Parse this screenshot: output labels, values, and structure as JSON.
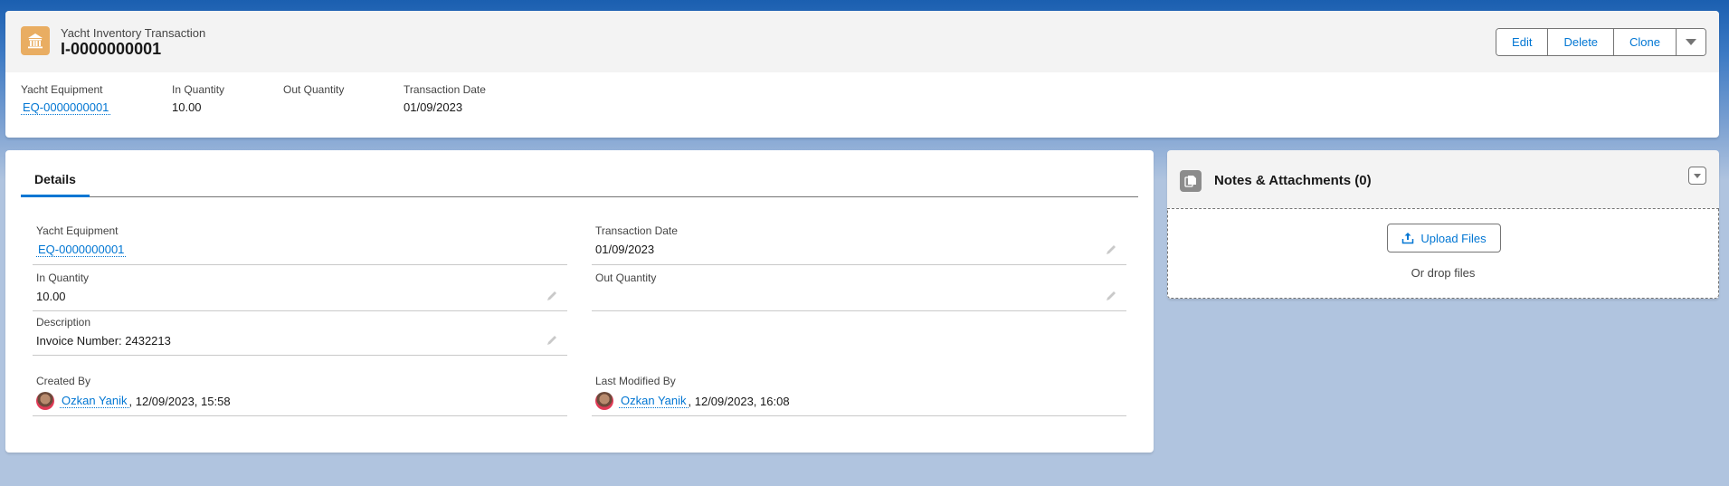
{
  "header": {
    "object_type": "Yacht Inventory Transaction",
    "record_name": "I-0000000001",
    "icon": "bank-building-icon",
    "icon_color": "#e9ad62",
    "actions": [
      "Edit",
      "Delete",
      "Clone"
    ],
    "more_actions_icon": "caret-down-icon",
    "highlights": [
      {
        "label": "Yacht Equipment",
        "value": "EQ-0000000001",
        "is_link": true
      },
      {
        "label": "In Quantity",
        "value": "10.00",
        "is_link": false
      },
      {
        "label": "Out Quantity",
        "value": "",
        "is_link": false
      },
      {
        "label": "Transaction Date",
        "value": "01/09/2023",
        "is_link": false
      }
    ]
  },
  "details": {
    "tab_label": "Details",
    "fields": {
      "yacht_equipment": {
        "label": "Yacht Equipment",
        "value": "EQ-0000000001"
      },
      "transaction_date": {
        "label": "Transaction Date",
        "value": "01/09/2023"
      },
      "in_quantity": {
        "label": "In Quantity",
        "value": "10.00"
      },
      "out_quantity": {
        "label": "Out Quantity",
        "value": ""
      },
      "description": {
        "label": "Description",
        "value": "Invoice Number: 2432213"
      },
      "created_by": {
        "label": "Created By",
        "user": "Ozkan Yanik",
        "timestamp": ", 12/09/2023, 15:58"
      },
      "last_modified_by": {
        "label": "Last Modified By",
        "user": "Ozkan Yanik",
        "timestamp": ", 12/09/2023, 16:08"
      }
    }
  },
  "notes": {
    "title": "Notes & Attachments (0)",
    "icon": "file-copy-icon",
    "upload_label": "Upload Files",
    "drop_text": "Or drop files"
  },
  "colors": {
    "brand": "#0176d3",
    "object_icon": "#e9ad62"
  }
}
